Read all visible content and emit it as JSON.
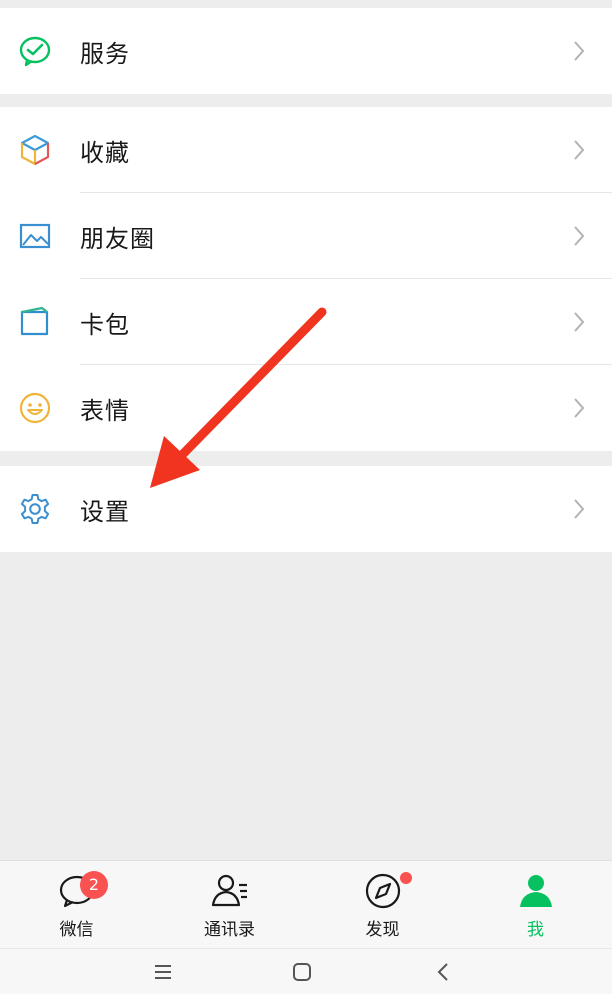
{
  "groups": {
    "services": {
      "label": "服务"
    },
    "collections": [
      {
        "label": "收藏"
      },
      {
        "label": "朋友圈"
      },
      {
        "label": "卡包"
      },
      {
        "label": "表情"
      }
    ],
    "settings": {
      "label": "设置"
    }
  },
  "icons": {
    "services": "wechat-pay-icon",
    "favorites": "cube-icon",
    "moments": "picture-icon",
    "cards": "wallet-icon",
    "stickers": "smiley-icon",
    "settings": "gear-icon"
  },
  "colors": {
    "accent": "#07c160",
    "badge": "#fa5151",
    "arrow": "#f0341f"
  },
  "tabbar": {
    "tabs": [
      {
        "label": "微信",
        "badge": "2"
      },
      {
        "label": "通讯录"
      },
      {
        "label": "发现"
      },
      {
        "label": "我"
      }
    ]
  }
}
